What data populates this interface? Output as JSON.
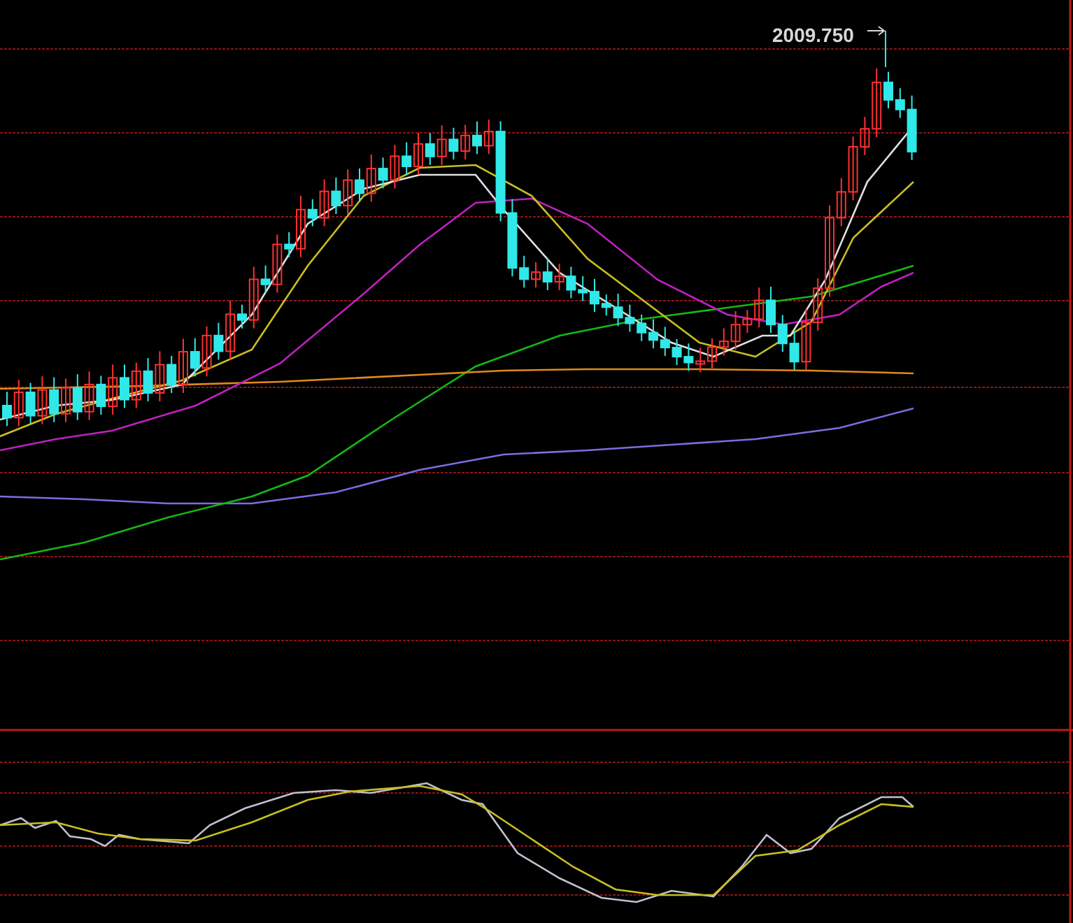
{
  "price_chart": {
    "high_label": "2009.750"
  }
}
